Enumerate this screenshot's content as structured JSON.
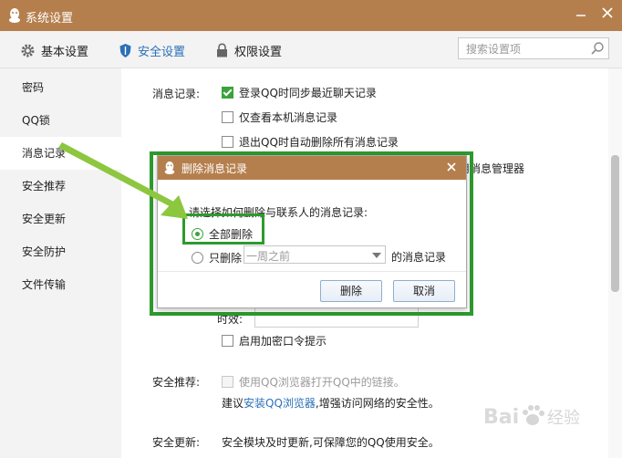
{
  "window": {
    "title": "系统设置"
  },
  "tabs": [
    {
      "label": "基本设置",
      "icon": "gear-icon"
    },
    {
      "label": "安全设置",
      "icon": "shield-icon"
    },
    {
      "label": "权限设置",
      "icon": "lock-icon"
    }
  ],
  "search": {
    "placeholder": "搜索设置项"
  },
  "sidebar": {
    "items": [
      {
        "label": "密码"
      },
      {
        "label": "QQ锁"
      },
      {
        "label": "消息记录",
        "active": true
      },
      {
        "label": "安全推荐"
      },
      {
        "label": "安全更新"
      },
      {
        "label": "安全防护"
      },
      {
        "label": "文件传输"
      }
    ]
  },
  "main": {
    "message_record": {
      "section_label": "消息记录:",
      "options": [
        {
          "label": "登录QQ时同步最近聊天记录",
          "checked": true
        },
        {
          "label": "仅查看本机消息记录",
          "checked": false
        },
        {
          "label": "退出QQ时自动删除所有消息记录",
          "checked": false
        },
        {
          "label": "用消息管理器",
          "checked": false
        }
      ]
    },
    "partial_label": "时效:",
    "encrypt_option": {
      "label": "启用加密口令提示",
      "checked": false
    },
    "safety_recommend": {
      "section_label": "安全推荐:",
      "option": "使用QQ浏览器打开QQ中的链接。",
      "suggest_prefix": "建议",
      "suggest_link": "安装QQ浏览器",
      "suggest_suffix": ",增强访问网络的安全性。"
    },
    "safety_update": {
      "section_label": "安全更新:",
      "text": "安全模块及时更新,可保障您的QQ使用安全。"
    }
  },
  "dialog": {
    "title": "删除消息记录",
    "prompt": "请选择如何删除与联系人的消息记录:",
    "option_all": "全部删除",
    "option_only": "只删除",
    "only_select_value": "一周之前",
    "only_suffix": "的消息记录",
    "delete_button": "删除",
    "cancel_button": "取消"
  },
  "colors": {
    "titlebar": "#b57f4d",
    "accent_blue": "#2a70b8",
    "highlight_green": "#2e9a2e",
    "check_green": "#3aa33a"
  },
  "watermark": "Baidu经验"
}
